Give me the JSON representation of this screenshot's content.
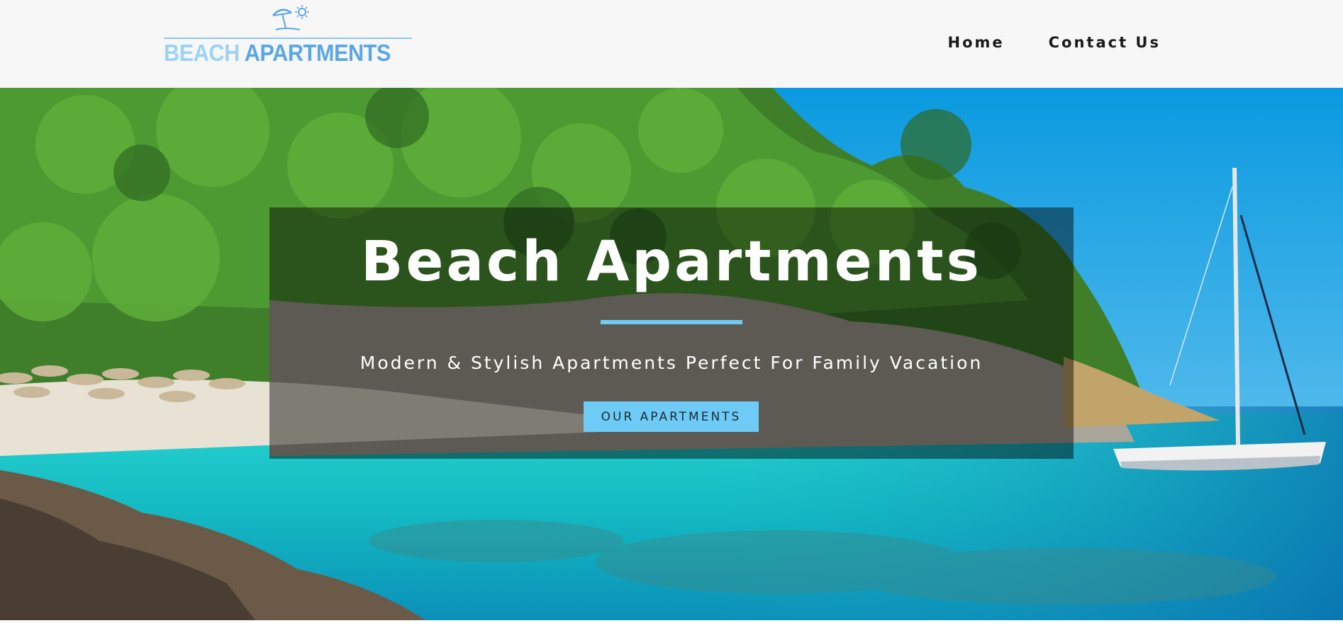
{
  "header": {
    "logo": {
      "word1": "BEACH",
      "word2": "APARTMENTS",
      "icon": "beach-umbrella-sun-icon",
      "color_light": "#9bd3f5",
      "color_dark": "#5aa7e6"
    },
    "nav": [
      {
        "label": "Home"
      },
      {
        "label": "Contact Us"
      }
    ]
  },
  "hero": {
    "image": "beach-cove-photo",
    "title": "Beach Apartments",
    "subtitle": "Modern & Stylish Apartments Perfect For Family Vacation",
    "cta_label": "OUR APARTMENTS",
    "accent_color": "#6ecbf5"
  }
}
